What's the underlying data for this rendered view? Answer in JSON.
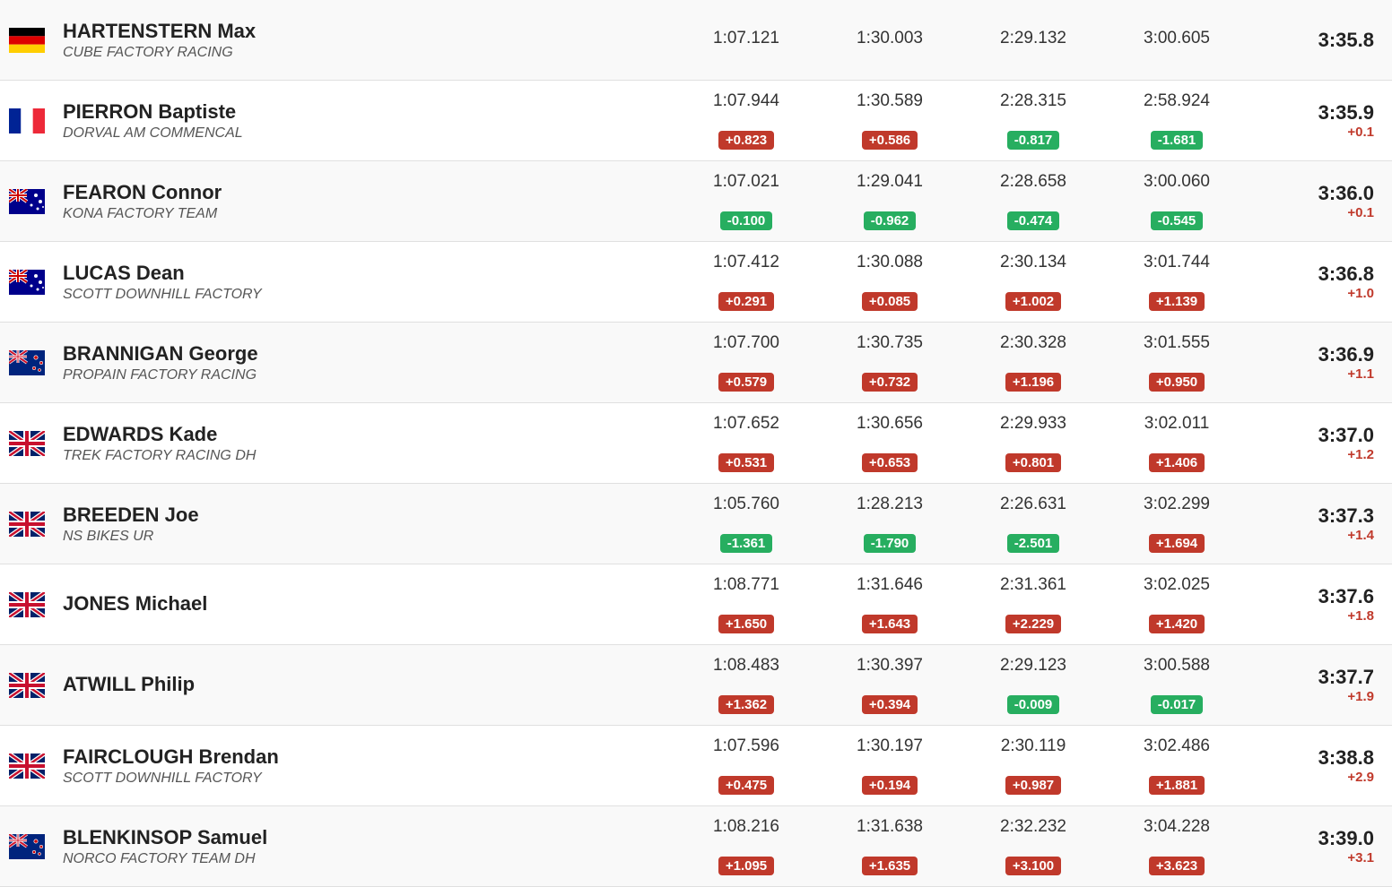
{
  "riders": [
    {
      "id": 1,
      "flag": "de",
      "name": "HARTENSTERN Max",
      "team": "CUBE FACTORY RACING",
      "split1": "1:07.121",
      "split2": "1:30.003",
      "split3": "2:29.132",
      "split4": "3:00.605",
      "final": "3:35.8",
      "diff1": null,
      "diff2": null,
      "diff3": null,
      "diff4": null,
      "finalDiff": null,
      "diff1Color": null,
      "diff2Color": null,
      "diff3Color": null,
      "diff4Color": null
    },
    {
      "id": 2,
      "flag": "fr",
      "name": "PIERRON Baptiste",
      "team": "DORVAL AM COMMENCAL",
      "split1": "1:07.944",
      "split2": "1:30.589",
      "split3": "2:28.315",
      "split4": "2:58.924",
      "final": "3:35.9",
      "diff1": "+0.823",
      "diff2": "+0.586",
      "diff3": "-0.817",
      "diff4": "-1.681",
      "finalDiff": "+0.1",
      "diff1Color": "red",
      "diff2Color": "red",
      "diff3Color": "green",
      "diff4Color": "green"
    },
    {
      "id": 3,
      "flag": "au",
      "name": "FEARON Connor",
      "team": "KONA FACTORY TEAM",
      "split1": "1:07.021",
      "split2": "1:29.041",
      "split3": "2:28.658",
      "split4": "3:00.060",
      "final": "3:36.0",
      "diff1": "-0.100",
      "diff2": "-0.962",
      "diff3": "-0.474",
      "diff4": "-0.545",
      "finalDiff": "+0.1",
      "diff1Color": "green",
      "diff2Color": "green",
      "diff3Color": "green",
      "diff4Color": "green"
    },
    {
      "id": 4,
      "flag": "au",
      "name": "LUCAS Dean",
      "team": "SCOTT DOWNHILL FACTORY",
      "split1": "1:07.412",
      "split2": "1:30.088",
      "split3": "2:30.134",
      "split4": "3:01.744",
      "final": "3:36.8",
      "diff1": "+0.291",
      "diff2": "+0.085",
      "diff3": "+1.002",
      "diff4": "+1.139",
      "finalDiff": "+1.0",
      "diff1Color": "red",
      "diff2Color": "red",
      "diff3Color": "red",
      "diff4Color": "red"
    },
    {
      "id": 5,
      "flag": "nz",
      "name": "BRANNIGAN George",
      "team": "PROPAIN FACTORY RACING",
      "split1": "1:07.700",
      "split2": "1:30.735",
      "split3": "2:30.328",
      "split4": "3:01.555",
      "final": "3:36.9",
      "diff1": "+0.579",
      "diff2": "+0.732",
      "diff3": "+1.196",
      "diff4": "+0.950",
      "finalDiff": "+1.1",
      "diff1Color": "red",
      "diff2Color": "red",
      "diff3Color": "red",
      "diff4Color": "red"
    },
    {
      "id": 6,
      "flag": "gb",
      "name": "EDWARDS Kade",
      "team": "TREK FACTORY RACING DH",
      "split1": "1:07.652",
      "split2": "1:30.656",
      "split3": "2:29.933",
      "split4": "3:02.011",
      "final": "3:37.0",
      "diff1": "+0.531",
      "diff2": "+0.653",
      "diff3": "+0.801",
      "diff4": "+1.406",
      "finalDiff": "+1.2",
      "diff1Color": "red",
      "diff2Color": "red",
      "diff3Color": "red",
      "diff4Color": "red"
    },
    {
      "id": 7,
      "flag": "gb",
      "name": "BREEDEN Joe",
      "team": "NS BIKES UR",
      "split1": "1:05.760",
      "split2": "1:28.213",
      "split3": "2:26.631",
      "split4": "3:02.299",
      "final": "3:37.3",
      "diff1": "-1.361",
      "diff2": "-1.790",
      "diff3": "-2.501",
      "diff4": "+1.694",
      "finalDiff": "+1.4",
      "diff1Color": "green",
      "diff2Color": "green",
      "diff3Color": "green",
      "diff4Color": "red"
    },
    {
      "id": 8,
      "flag": "gb",
      "name": "JONES Michael",
      "team": "",
      "split1": "1:08.771",
      "split2": "1:31.646",
      "split3": "2:31.361",
      "split4": "3:02.025",
      "final": "3:37.6",
      "diff1": "+1.650",
      "diff2": "+1.643",
      "diff3": "+2.229",
      "diff4": "+1.420",
      "finalDiff": "+1.8",
      "diff1Color": "red",
      "diff2Color": "red",
      "diff3Color": "red",
      "diff4Color": "red"
    },
    {
      "id": 9,
      "flag": "gb",
      "name": "ATWILL Philip",
      "team": "",
      "split1": "1:08.483",
      "split2": "1:30.397",
      "split3": "2:29.123",
      "split4": "3:00.588",
      "final": "3:37.7",
      "diff1": "+1.362",
      "diff2": "+0.394",
      "diff3": "-0.009",
      "diff4": "-0.017",
      "finalDiff": "+1.9",
      "diff1Color": "red",
      "diff2Color": "red",
      "diff3Color": "green",
      "diff4Color": "green"
    },
    {
      "id": 10,
      "flag": "gb",
      "name": "FAIRCLOUGH Brendan",
      "team": "SCOTT DOWNHILL FACTORY",
      "split1": "1:07.596",
      "split2": "1:30.197",
      "split3": "2:30.119",
      "split4": "3:02.486",
      "final": "3:38.8",
      "diff1": "+0.475",
      "diff2": "+0.194",
      "diff3": "+0.987",
      "diff4": "+1.881",
      "finalDiff": "+2.9",
      "diff1Color": "red",
      "diff2Color": "red",
      "diff3Color": "red",
      "diff4Color": "red"
    },
    {
      "id": 11,
      "flag": "nz",
      "name": "BLENKINSOP Samuel",
      "team": "NORCO FACTORY TEAM DH",
      "split1": "1:08.216",
      "split2": "1:31.638",
      "split3": "2:32.232",
      "split4": "3:04.228",
      "final": "3:39.0",
      "diff1": "+1.095",
      "diff2": "+1.635",
      "diff3": "+3.100",
      "diff4": "+3.623",
      "finalDiff": "+3.1",
      "diff1Color": "red",
      "diff2Color": "red",
      "diff3Color": "red",
      "diff4Color": "red"
    }
  ]
}
